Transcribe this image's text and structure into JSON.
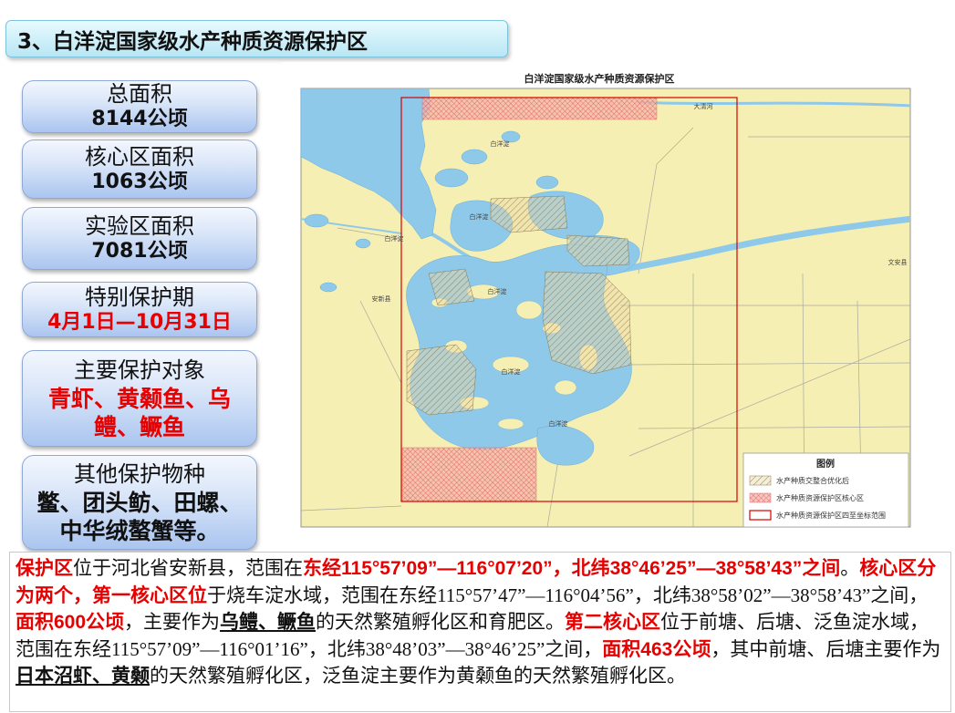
{
  "colors": {
    "highlight": "#e60000",
    "title_bg": "#b9e6f4",
    "box_bg": "#aac5ef",
    "lake": "#8ec9ea",
    "land": "#f6efb3"
  },
  "slide": {
    "title": "3、白洋淀国家级水产种质资源保护区",
    "stats": [
      {
        "label": "总面积",
        "value": "8144公顷"
      },
      {
        "label": "核心区面积",
        "value": "1063公顷"
      },
      {
        "label": "实验区面积",
        "value": "7081公顷"
      },
      {
        "label": "特别保护期",
        "value": "4月1日—10月31日"
      },
      {
        "label": "主要保护对象",
        "value": "青虾、黄颡鱼、乌鳢、鳜鱼"
      },
      {
        "label": "其他保护物种",
        "value": "鳖、团头鲂、田螺、中华绒螯蟹等。"
      }
    ]
  },
  "map": {
    "title": "白洋淀国家级水产种质资源保护区",
    "places": [
      "安新县",
      "文安县",
      "大清河",
      "白洋淀",
      "白洋淀",
      "白洋淀",
      "白洋淀",
      "白洋淀",
      "白洋淀"
    ],
    "legend": {
      "title": "图例",
      "items": [
        {
          "label": "水产种质交整合优化后"
        },
        {
          "label": "水产种质资源保护区核心区"
        },
        {
          "label": "水产种质资源保护区四至坐标范围"
        }
      ]
    }
  },
  "description": {
    "segments": [
      "保护区",
      "位于河北省安新县，范围在",
      "东经115°57’09”—116°07’20”，北纬38°46’25”—38°58’43”之间",
      "。",
      "核心区分为两个，",
      "第一核心区位",
      "于烧车淀水域，范围在东经115°57’47”—116°04’56”，北纬38°58’02”—38°58’43”之间，",
      "面积600公顷",
      "，主要作为",
      "乌鳢、鳜鱼",
      "的天然繁殖孵化区和育肥区。",
      "第二核心区",
      "位于前塘、后塘、泛鱼淀水域，范围在东经115°57’09”—116°01’16”，北纬38°48’03”—38°46’25”之间，",
      "面积463公顷",
      "，其中前塘、后塘主要作为",
      "日本沼虾、黄颡",
      "的天然繁殖孵化区，泛鱼淀主要作为黄颡鱼的天然繁殖孵化区。"
    ]
  }
}
